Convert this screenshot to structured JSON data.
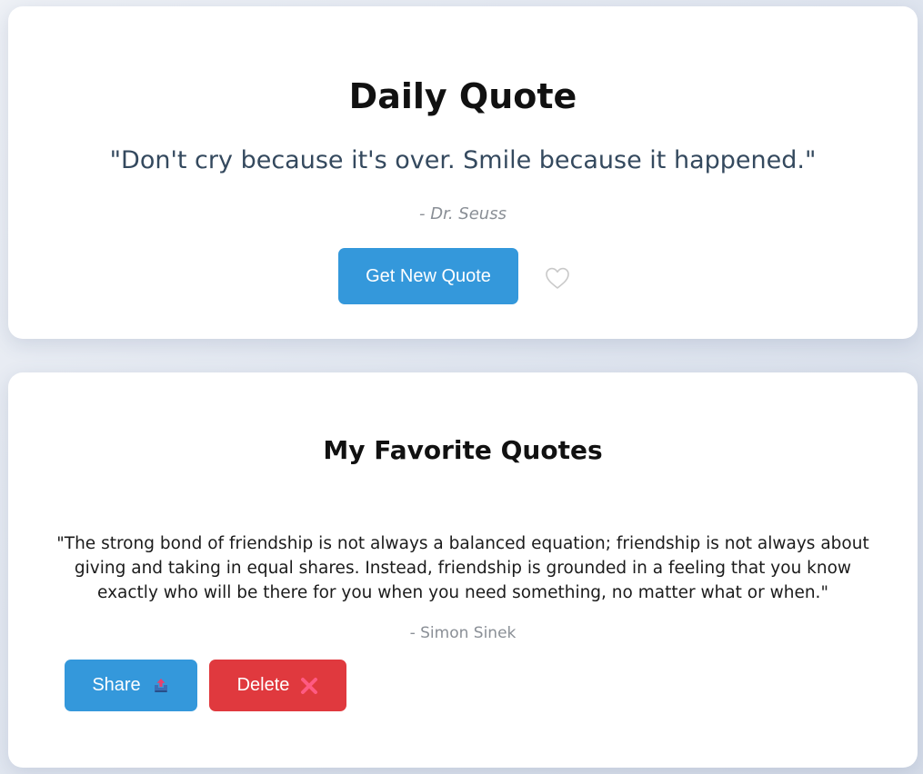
{
  "daily": {
    "title": "Daily Quote",
    "quote": "\"Don't cry because it's over. Smile because it happened.\"",
    "author": "- Dr. Seuss",
    "new_quote_label": "Get New Quote",
    "favorite_icon": "heart-outline"
  },
  "favorites": {
    "title": "My Favorite Quotes",
    "items": [
      {
        "quote": "\"The strong bond of friendship is not always a balanced equation; friendship is not always about giving and taking in equal shares. Instead, friendship is grounded in a feeling that you know exactly who will be there for you when you need something, no matter what or when.\"",
        "author": "- Simon Sinek",
        "share_label": "Share",
        "share_icon": "outbox-tray",
        "delete_label": "Delete",
        "delete_icon": "cross-mark"
      }
    ]
  },
  "colors": {
    "primary": "#3498db",
    "danger": "#e0393e",
    "quote_text": "#34495e",
    "muted": "#8a8f96"
  }
}
